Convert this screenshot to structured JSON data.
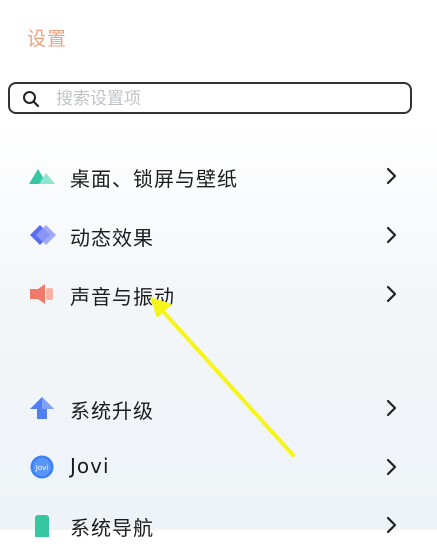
{
  "header": {
    "title": "设置"
  },
  "search": {
    "placeholder": "搜索设置项"
  },
  "settings": {
    "items": [
      {
        "label": "桌面、锁屏与壁纸",
        "icon": "mountain-icon",
        "color": "#3cc9a8"
      },
      {
        "label": "动态效果",
        "icon": "diamond-icon",
        "color": "#5b6df0"
      },
      {
        "label": "声音与振动",
        "icon": "speaker-icon",
        "color": "#f07a6a"
      },
      {
        "label": "系统升级",
        "icon": "upload-arrow-icon",
        "color": "#4f7ef5"
      },
      {
        "label": "Jovi",
        "icon": "jovi-icon",
        "icon_text": "Jovi",
        "color": "#3d7ff6"
      },
      {
        "label": "系统导航",
        "icon": "phone-icon",
        "color": "#36c7a2"
      }
    ]
  },
  "annotation": {
    "color": "#f5f51a"
  },
  "colors": {
    "title": "#f0a27f",
    "text": "#1c1c1c",
    "chevron": "#222222"
  }
}
